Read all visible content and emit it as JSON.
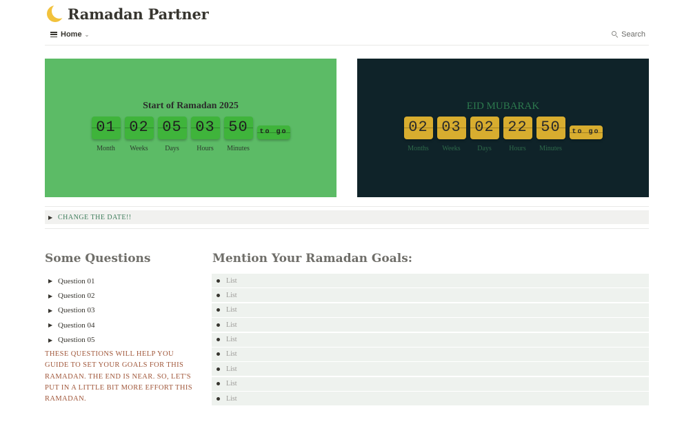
{
  "page": {
    "title": "Ramadan Partner",
    "icon": "crescent-moon-icon"
  },
  "nav": {
    "home_label": "Home",
    "search_label": "Search"
  },
  "countdown_start": {
    "title": "Start of Ramadan 2025",
    "units": [
      {
        "value": "01",
        "label": "Month"
      },
      {
        "value": "02",
        "label": "Weeks"
      },
      {
        "value": "05",
        "label": "Days"
      },
      {
        "value": "03",
        "label": "Hours"
      },
      {
        "value": "50",
        "label": "Minutes"
      }
    ],
    "suffix": "to go",
    "bg_color": "#5cbb66",
    "tile_color": "#3fb43b"
  },
  "countdown_eid": {
    "title": "EID MUBARAK",
    "units": [
      {
        "value": "02",
        "label": "Months"
      },
      {
        "value": "03",
        "label": "Weeks"
      },
      {
        "value": "02",
        "label": "Days"
      },
      {
        "value": "22",
        "label": "Hours"
      },
      {
        "value": "50",
        "label": "Minutes"
      }
    ],
    "suffix": "to go",
    "bg_color": "#0f2329",
    "tile_color": "#d8ad2f"
  },
  "change_date_toggle": "CHANGE THE DATE!!",
  "questions": {
    "heading": "Some Questions",
    "items": [
      "Question 01",
      "Question 02",
      "Question 03",
      "Question 04",
      "Question 05"
    ],
    "note": "THESE QUESTIONS WILL HELP YOU GUIDE TO SET YOUR GOALS FOR THIS RAMADAN. THE END IS NEAR. SO, LET'S PUT IN A LITTLE BIT MORE EFFORT THIS RAMADAN."
  },
  "goals": {
    "heading": "Mention Your Ramadan Goals:",
    "items": [
      "List",
      "List",
      "List",
      "List",
      "List",
      "List",
      "List",
      "List",
      "List"
    ]
  }
}
